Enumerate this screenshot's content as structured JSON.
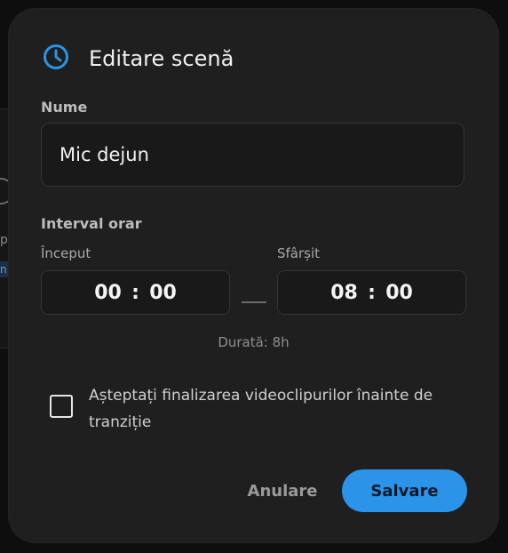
{
  "dialog": {
    "title": "Editare scenă",
    "icon": "clock-icon",
    "accent_color": "#2b93e8"
  },
  "name_field": {
    "label": "Nume",
    "value": "Mic dejun"
  },
  "interval": {
    "label": "Interval orar",
    "start": {
      "label": "Început",
      "hours": "00",
      "minutes": "00"
    },
    "end": {
      "label": "Sfârșit",
      "hours": "08",
      "minutes": "00"
    },
    "separator": ":",
    "duration": "Durată: 8h"
  },
  "wait_option": {
    "label": "Așteptați finalizarea videoclipurilor înainte de tranziție",
    "checked": false
  },
  "actions": {
    "cancel_label": "Anulare",
    "save_label": "Salvare"
  },
  "background": {
    "fragment_text": "p",
    "chip_text": "n"
  }
}
